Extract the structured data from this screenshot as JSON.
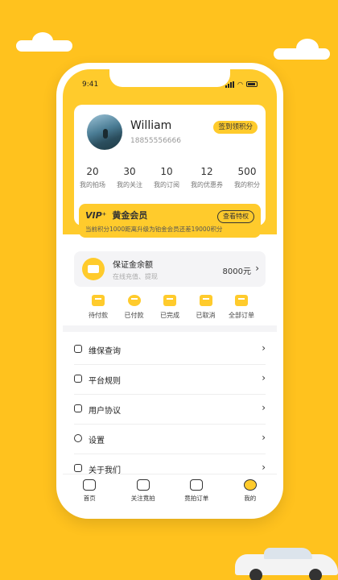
{
  "status_bar": {
    "time": "9:41"
  },
  "profile": {
    "name": "William",
    "phone": "18855556666",
    "sign_button": "签到领积分",
    "stats": [
      {
        "value": "20",
        "label": "我的拍场"
      },
      {
        "value": "30",
        "label": "我的关注"
      },
      {
        "value": "10",
        "label": "我的订阅"
      },
      {
        "value": "12",
        "label": "我的优惠券"
      },
      {
        "value": "500",
        "label": "我的积分"
      }
    ]
  },
  "vip": {
    "mark": "VIP⁺",
    "title": "黄金会员",
    "button": "查看特权",
    "subtitle": "当前积分1000距离升级为铂金会员还差19000积分"
  },
  "deposit": {
    "title": "保证金余额",
    "subtitle": "在线充值、提现",
    "amount": "8000元"
  },
  "orders": [
    {
      "label": "待付款"
    },
    {
      "label": "已付款"
    },
    {
      "label": "已完成"
    },
    {
      "label": "已取消"
    },
    {
      "label": "全部订单"
    }
  ],
  "menu": [
    {
      "label": "维保查询"
    },
    {
      "label": "平台规则"
    },
    {
      "label": "用户协议"
    },
    {
      "label": "设置"
    },
    {
      "label": "关于我们"
    }
  ],
  "tabs": [
    {
      "label": "首页"
    },
    {
      "label": "关注竟拍"
    },
    {
      "label": "竟拍订单"
    },
    {
      "label": "我的"
    }
  ]
}
